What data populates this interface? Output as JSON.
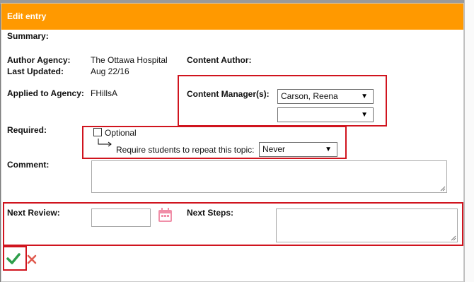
{
  "dialog": {
    "title": "Edit entry"
  },
  "fields": {
    "summary_label": "Summary:",
    "author_agency_label": "Author Agency:",
    "author_agency_value": "The Ottawa Hospital",
    "last_updated_label": "Last Updated:",
    "last_updated_value": "Aug 22/16",
    "content_author_label": "Content Author:",
    "applied_agency_label": "Applied to Agency:",
    "applied_agency_value": "FHillsA",
    "content_managers_label": "Content Manager(s):",
    "content_manager_1": "Carson, Reena",
    "content_manager_2": "",
    "required_label": "Required:",
    "optional_label": "Optional",
    "repeat_label": "Require students to repeat this topic:",
    "repeat_value": "Never",
    "comment_label": "Comment:",
    "next_review_label": "Next Review:",
    "next_steps_label": "Next Steps:"
  },
  "colors": {
    "titlebar": "#ff9900",
    "highlight": "#d0141e",
    "save": "#2e9e4a",
    "cancel": "#e05a4e",
    "calendar": "#f08fa8"
  },
  "icons": {
    "arrow": "down-triangle",
    "calendar": "calendar-icon",
    "save": "checkmark-icon",
    "cancel": "x-icon",
    "branch": "elbow-arrow-icon"
  }
}
